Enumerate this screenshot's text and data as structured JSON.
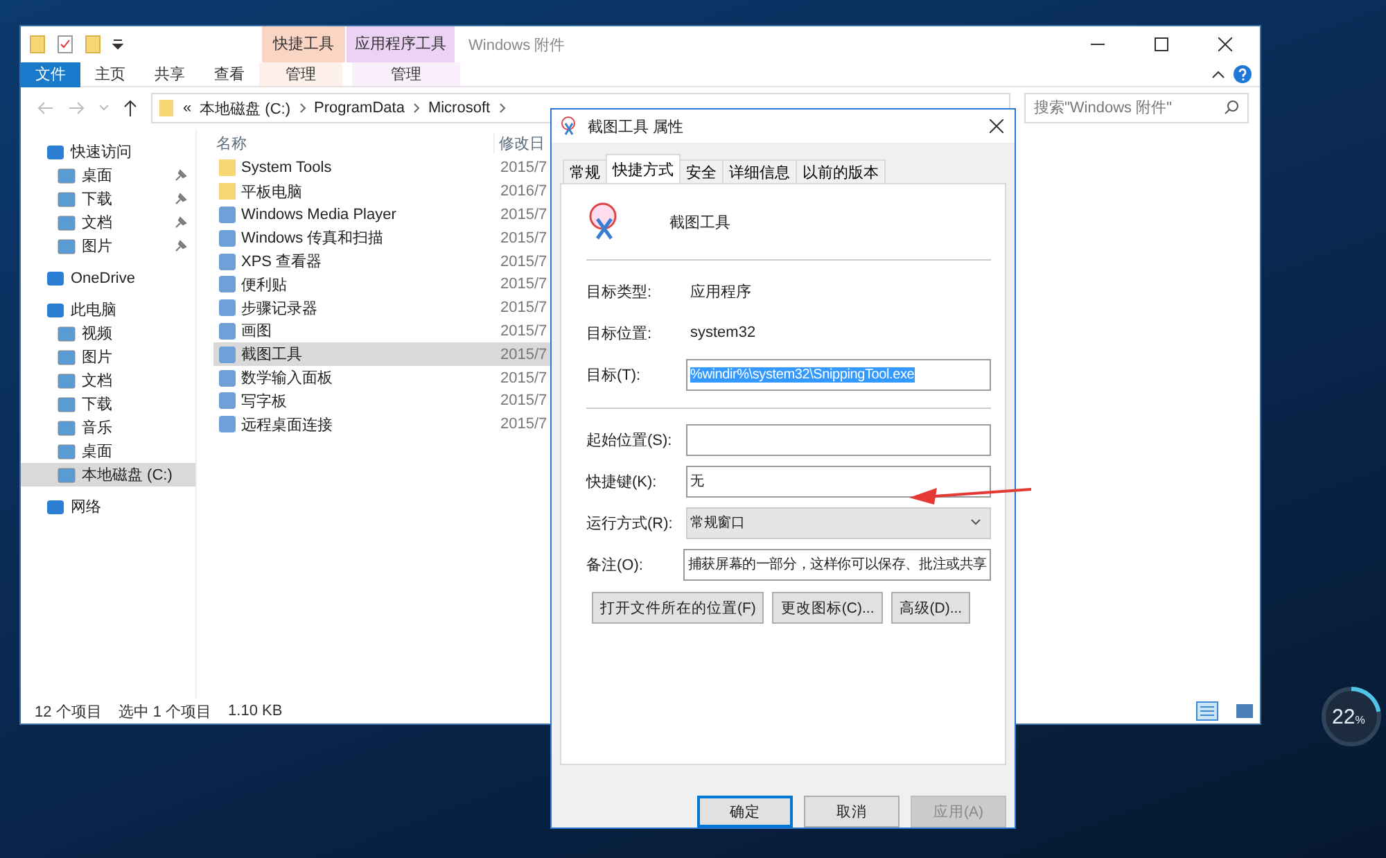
{
  "explorer": {
    "title": "Windows 附件",
    "context_tabs": [
      {
        "group": "快捷工具",
        "label": "管理",
        "color": "#fbd5c4"
      },
      {
        "group": "应用程序工具",
        "label": "管理",
        "color": "#ecd3f5"
      }
    ],
    "ribbon_tabs": [
      {
        "label": "文件",
        "selected": true
      },
      {
        "label": "主页",
        "selected": false
      },
      {
        "label": "共享",
        "selected": false
      },
      {
        "label": "查看",
        "selected": false
      }
    ],
    "overflow": "«",
    "breadcrumbs": [
      "本地磁盘 (C:)",
      "ProgramData",
      "Microsoft"
    ],
    "search": {
      "placeholder": "搜索\"Windows 附件\""
    },
    "sidebar": [
      {
        "label": "快速访问",
        "selected": false,
        "children": [
          {
            "label": "桌面",
            "pinned": true,
            "selected": false
          },
          {
            "label": "下载",
            "pinned": true,
            "selected": false
          },
          {
            "label": "文档",
            "pinned": true,
            "selected": false
          },
          {
            "label": "图片",
            "pinned": true,
            "selected": false
          }
        ]
      },
      {
        "label": "OneDrive",
        "selected": false
      },
      {
        "label": "此电脑",
        "selected": false,
        "children": [
          {
            "label": "视频",
            "pinned": false,
            "selected": false
          },
          {
            "label": "图片",
            "pinned": false,
            "selected": false
          },
          {
            "label": "文档",
            "pinned": false,
            "selected": false
          },
          {
            "label": "下载",
            "pinned": false,
            "selected": false
          },
          {
            "label": "音乐",
            "pinned": false,
            "selected": false
          },
          {
            "label": "桌面",
            "pinned": false,
            "selected": false
          },
          {
            "label": "本地磁盘 (C:)",
            "pinned": false,
            "selected": true
          }
        ]
      },
      {
        "label": "网络",
        "selected": false
      }
    ],
    "columns": [
      "名称",
      "修改日"
    ],
    "files": [
      {
        "name": "System Tools",
        "date": "2015/7",
        "kind": "folder",
        "selected": false
      },
      {
        "name": "平板电脑",
        "date": "2016/7",
        "kind": "folder",
        "selected": false
      },
      {
        "name": "Windows Media Player",
        "date": "2015/7",
        "kind": "app",
        "selected": false
      },
      {
        "name": "Windows 传真和扫描",
        "date": "2015/7",
        "kind": "app",
        "selected": false
      },
      {
        "name": "XPS 查看器",
        "date": "2015/7",
        "kind": "app",
        "selected": false
      },
      {
        "name": "便利贴",
        "date": "2015/7",
        "kind": "app",
        "selected": false
      },
      {
        "name": "步骤记录器",
        "date": "2015/7",
        "kind": "app",
        "selected": false
      },
      {
        "name": "画图",
        "date": "2015/7",
        "kind": "app",
        "selected": false
      },
      {
        "name": "截图工具",
        "date": "2015/7",
        "kind": "app",
        "selected": true
      },
      {
        "name": "数学输入面板",
        "date": "2015/7",
        "kind": "app",
        "selected": false
      },
      {
        "name": "写字板",
        "date": "2015/7",
        "kind": "app",
        "selected": false
      },
      {
        "name": "远程桌面连接",
        "date": "2015/7",
        "kind": "app",
        "selected": false
      }
    ],
    "status_bar": [
      "12 个项目",
      "选中 1 个项目",
      "1.10 KB"
    ]
  },
  "dialog": {
    "title": "截图工具 属性",
    "tabs": [
      {
        "label": "常规",
        "selected": false
      },
      {
        "label": "快捷方式",
        "selected": true
      },
      {
        "label": "安全",
        "selected": false
      },
      {
        "label": "详细信息",
        "selected": false
      },
      {
        "label": "以前的版本",
        "selected": false
      }
    ],
    "name": "截图工具",
    "fields": [
      {
        "kind": "text",
        "label": "目标类型:",
        "value": "应用程序"
      },
      {
        "kind": "text",
        "label": "目标位置:",
        "value": "system32"
      },
      {
        "kind": "input",
        "label": "目标(T):",
        "value": "%windir%\\system32\\SnippingTool.exe",
        "highlighted": true
      },
      {
        "kind": "divider"
      },
      {
        "kind": "input",
        "label": "起始位置(S):"
      },
      {
        "kind": "input",
        "label": "快捷键(K):",
        "value": "无",
        "highlighted": false
      },
      {
        "kind": "select",
        "label": "运行方式(R):",
        "value": "常规窗口"
      },
      {
        "kind": "input",
        "label": "备注(O):",
        "value": "捕获屏幕的一部分，这样你可以保存、批注或共享",
        "highlighted": false
      }
    ],
    "actions": [
      "打开文件所在的位置(F)",
      "更改图标(C)...",
      "高级(D)..."
    ],
    "buttons": [
      {
        "label": "确定",
        "disabled": false
      },
      {
        "label": "取消",
        "disabled": false
      },
      {
        "label": "应用(A)",
        "disabled": true
      }
    ]
  },
  "widget": {
    "value": "22",
    "unit": "%",
    "level": 0.22
  }
}
